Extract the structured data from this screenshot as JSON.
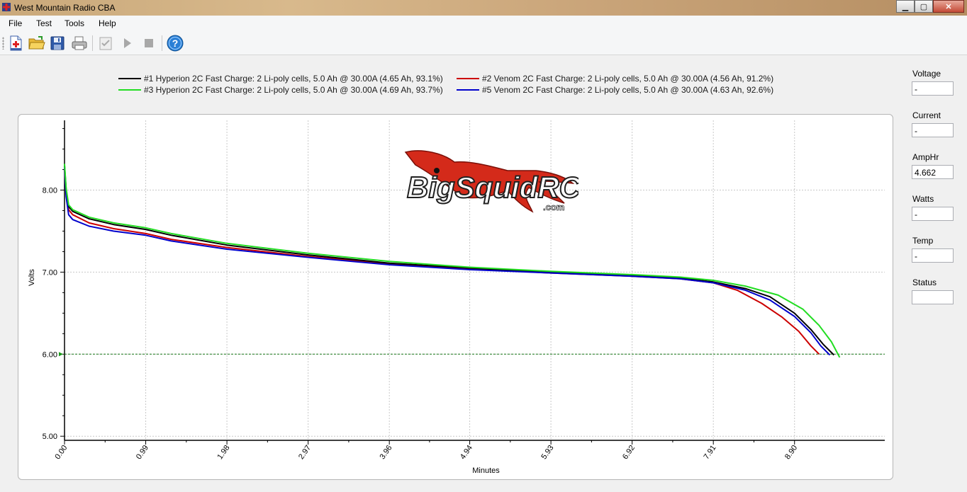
{
  "window": {
    "title": "West Mountain Radio CBA",
    "buttons": {
      "minimize": "▁",
      "maximize": "▢",
      "close": "✕"
    }
  },
  "menu": [
    "File",
    "Test",
    "Tools",
    "Help"
  ],
  "toolbar": {
    "icons": [
      "new-test-icon",
      "open-folder-icon",
      "save-icon",
      "print-icon",
      "checklist-icon",
      "play-icon",
      "stop-icon",
      "help-icon"
    ]
  },
  "legend": [
    {
      "label": "#1 Hyperion 2C Fast Charge: 2 Li-poly cells, 5.0 Ah @ 30.00A (4.65 Ah, 93.1%)",
      "color": "#000000"
    },
    {
      "label": "#2 Venom 2C Fast Charge: 2 Li-poly cells, 5.0 Ah @ 30.00A (4.56 Ah, 91.2%)",
      "color": "#cc0000"
    },
    {
      "label": "#3 Hyperion 2C Fast Charge: 2 Li-poly cells, 5.0 Ah @ 30.00A (4.69 Ah, 93.7%)",
      "color": "#22dd22"
    },
    {
      "label": "#5 Venom 2C Fast Charge: 2 Li-poly cells, 5.0 Ah @ 30.00A (4.63 Ah, 92.6%)",
      "color": "#0000cc"
    }
  ],
  "watermark": {
    "text": "BigSquidRC",
    "suffix": ".com"
  },
  "chart_data": {
    "type": "line",
    "xlabel": "Minutes",
    "ylabel": "Volts",
    "xlim": [
      0,
      10
    ],
    "ylim": [
      4.95,
      8.85
    ],
    "x_ticks": [
      "0.00",
      "0.99",
      "1.98",
      "2.97",
      "3.96",
      "4.94",
      "5.93",
      "6.92",
      "7.91",
      "8.90"
    ],
    "y_ticks": [
      "5.00",
      "6.00",
      "7.00",
      "8.00"
    ],
    "cutoff_voltage": 6.0,
    "series": [
      {
        "name": "#1 Hyperion 2C Fast Charge: 2 Li-poly cells, 5.0 Ah @ 30.00A (4.65 Ah, 93.1%)",
        "color": "#000000",
        "x": [
          0,
          0.02,
          0.05,
          0.1,
          0.3,
          0.6,
          0.99,
          1.3,
          1.98,
          2.97,
          3.96,
          4.94,
          5.93,
          6.92,
          7.5,
          7.91,
          8.3,
          8.6,
          8.9,
          9.1,
          9.25,
          9.38
        ],
        "y": [
          8.3,
          8.0,
          7.8,
          7.74,
          7.65,
          7.58,
          7.52,
          7.45,
          7.33,
          7.21,
          7.11,
          7.05,
          7.0,
          6.96,
          6.93,
          6.88,
          6.8,
          6.7,
          6.5,
          6.3,
          6.12,
          5.99
        ]
      },
      {
        "name": "#2 Venom 2C Fast Charge: 2 Li-poly cells, 5.0 Ah @ 30.00A (4.56 Ah, 91.2%)",
        "color": "#cc0000",
        "x": [
          0,
          0.02,
          0.05,
          0.1,
          0.3,
          0.6,
          0.99,
          1.3,
          1.98,
          2.97,
          3.96,
          4.94,
          5.93,
          6.92,
          7.5,
          7.91,
          8.2,
          8.5,
          8.75,
          8.95,
          9.1,
          9.2
        ],
        "y": [
          8.25,
          7.95,
          7.76,
          7.7,
          7.6,
          7.53,
          7.47,
          7.4,
          7.3,
          7.19,
          7.1,
          7.04,
          6.99,
          6.95,
          6.92,
          6.87,
          6.78,
          6.62,
          6.45,
          6.28,
          6.1,
          6.0
        ]
      },
      {
        "name": "#3 Hyperion 2C Fast Charge: 2 Li-poly cells, 5.0 Ah @ 30.00A (4.69 Ah, 93.7%)",
        "color": "#22dd22",
        "x": [
          0,
          0.02,
          0.05,
          0.1,
          0.3,
          0.6,
          0.99,
          1.3,
          1.98,
          2.97,
          3.96,
          4.94,
          5.93,
          6.92,
          7.5,
          7.91,
          8.3,
          8.7,
          9.0,
          9.2,
          9.35,
          9.45
        ],
        "y": [
          8.32,
          8.02,
          7.82,
          7.76,
          7.67,
          7.6,
          7.54,
          7.47,
          7.35,
          7.23,
          7.13,
          7.06,
          7.01,
          6.97,
          6.94,
          6.9,
          6.83,
          6.72,
          6.55,
          6.35,
          6.15,
          5.96
        ]
      },
      {
        "name": "#5 Venom 2C Fast Charge: 2 Li-poly cells, 5.0 Ah @ 30.00A (4.63 Ah, 92.6%)",
        "color": "#0000cc",
        "x": [
          0,
          0.02,
          0.05,
          0.1,
          0.3,
          0.6,
          0.99,
          1.3,
          1.98,
          2.97,
          3.96,
          4.94,
          5.93,
          6.92,
          7.5,
          7.91,
          8.3,
          8.6,
          8.9,
          9.1,
          9.22,
          9.33
        ],
        "y": [
          8.28,
          7.92,
          7.7,
          7.64,
          7.56,
          7.5,
          7.45,
          7.38,
          7.28,
          7.18,
          7.09,
          7.03,
          6.99,
          6.95,
          6.92,
          6.87,
          6.78,
          6.66,
          6.46,
          6.26,
          6.1,
          5.99
        ]
      }
    ]
  },
  "side": [
    {
      "label": "Voltage",
      "value": "-"
    },
    {
      "label": "Current",
      "value": "-"
    },
    {
      "label": "AmpHr",
      "value": "4.662"
    },
    {
      "label": "Watts",
      "value": "-"
    },
    {
      "label": "Temp",
      "value": "-"
    },
    {
      "label": "Status",
      "value": ""
    }
  ]
}
